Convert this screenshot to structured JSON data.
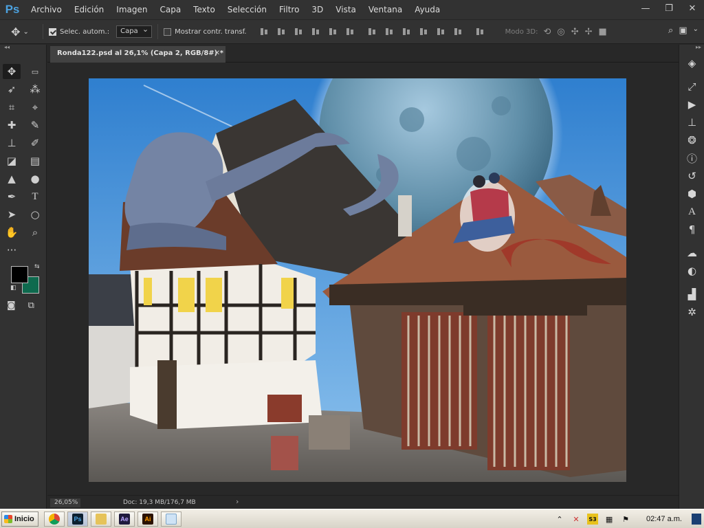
{
  "app": {
    "logo": "Ps",
    "accent_color": "#4ca2e0"
  },
  "menubar": {
    "items": [
      "Archivo",
      "Edición",
      "Imagen",
      "Capa",
      "Texto",
      "Selección",
      "Filtro",
      "3D",
      "Vista",
      "Ventana",
      "Ayuda"
    ],
    "window_controls": [
      "minimize-icon",
      "restore-icon",
      "close-icon"
    ]
  },
  "options_bar": {
    "auto_select_label": "Selec. autom.:",
    "auto_select_checked": true,
    "auto_select_target": "Capa",
    "show_transform_label": "Mostrar contr. transf.",
    "show_transform_checked": false,
    "mode_3d_label": "Modo 3D:"
  },
  "document": {
    "tab_title": "Ronda122.psd al 26,1% (Capa 2, RGB/8#) *",
    "zoom": "26,05%",
    "doc_size": "Doc: 19,3 MB/176,7 MB",
    "canvas_description_colors": {
      "sky": "#3f8fd6",
      "ground": "#6e6a66"
    }
  },
  "toolbar": {
    "tools": [
      "move-tool",
      "artboard-tool",
      "lasso-tool",
      "magic-wand-tool",
      "crop-tool",
      "eyedropper-tool",
      "healing-brush-tool",
      "brush-tool",
      "clone-stamp-tool",
      "history-brush-tool",
      "eraser-tool",
      "gradient-tool",
      "blur-tool",
      "dodge-tool",
      "pen-tool",
      "type-tool",
      "path-selection-tool",
      "ellipse-tool",
      "hand-tool",
      "zoom-tool",
      "more-tools"
    ],
    "foreground_color": "#000000",
    "background_color": "#0e6a4e"
  },
  "right_panel": {
    "icons": [
      "layers-icon",
      "paths-icon",
      "actions-icon",
      "clone-source-icon",
      "channels-icon",
      "info-icon",
      "history-icon",
      "3d-icon",
      "character-icon",
      "paragraph-icon",
      "libraries-icon",
      "adjustments-icon",
      "histogram-icon",
      "navigator-icon"
    ]
  },
  "taskbar": {
    "start_label": "Inicio",
    "apps": [
      "Chrome",
      "Ps",
      "Explorer",
      "Ae",
      "Ai",
      "Paint"
    ],
    "clock": "02:47 a.m."
  }
}
